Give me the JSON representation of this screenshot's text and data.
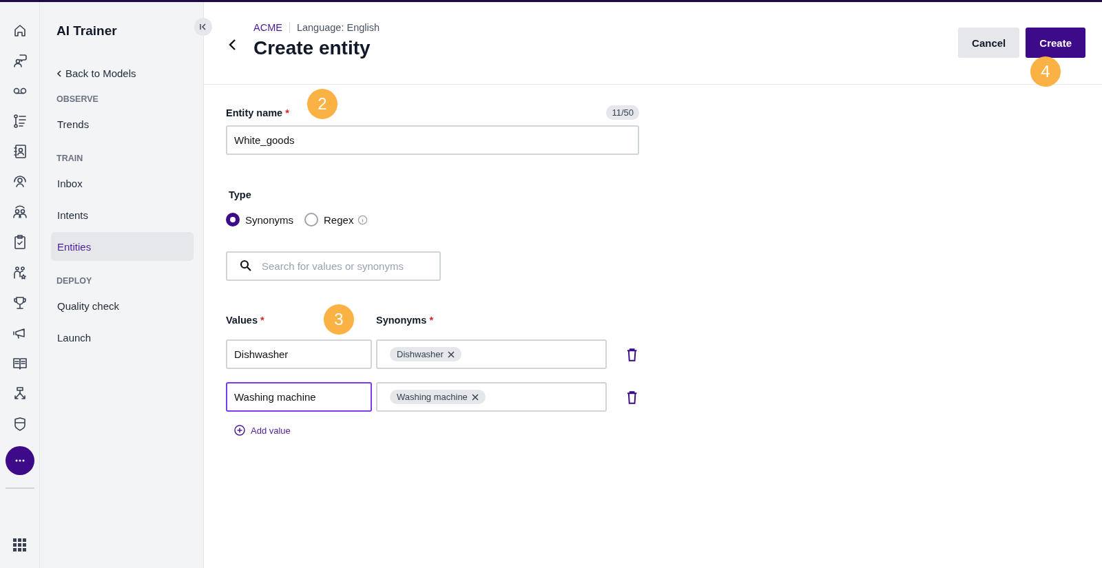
{
  "sidebar": {
    "title": "AI Trainer",
    "back_link": "Back to Models",
    "sections": [
      {
        "heading": "OBSERVE",
        "items": [
          {
            "label": "Trends",
            "selected": false
          }
        ]
      },
      {
        "heading": "TRAIN",
        "items": [
          {
            "label": "Inbox",
            "selected": false
          },
          {
            "label": "Intents",
            "selected": false
          },
          {
            "label": "Entities",
            "selected": true
          }
        ]
      },
      {
        "heading": "DEPLOY",
        "items": [
          {
            "label": "Quality check",
            "selected": false
          },
          {
            "label": "Launch",
            "selected": false
          }
        ]
      }
    ]
  },
  "header": {
    "org": "ACME",
    "language": "Language: English",
    "title": "Create entity",
    "step_badge": "4",
    "buttons": [
      {
        "label": "Cancel",
        "kind": "secondary"
      },
      {
        "label": "Create",
        "kind": "primary"
      }
    ]
  },
  "form": {
    "entity_name": {
      "label": "Entity name",
      "required_mark": "*",
      "counter": "11/50",
      "value": "White_goods",
      "step_badge": "2"
    },
    "type": {
      "label": "Type",
      "options": [
        {
          "label": "Synonyms",
          "selected": true,
          "info": false
        },
        {
          "label": "Regex",
          "selected": false,
          "info": true
        }
      ]
    },
    "search": {
      "placeholder": "Search for values or synonyms"
    },
    "columns": [
      {
        "label": "Values",
        "required_mark": "*"
      },
      {
        "label": "Synonyms",
        "required_mark": "*"
      }
    ],
    "columns_step_badge": "3",
    "rows": [
      {
        "value": "Dishwasher",
        "focused": false,
        "synonyms": [
          "Dishwasher"
        ]
      },
      {
        "value": "Washing machine",
        "focused": true,
        "synonyms": [
          "Washing machine"
        ]
      }
    ],
    "add_value": "Add value"
  }
}
